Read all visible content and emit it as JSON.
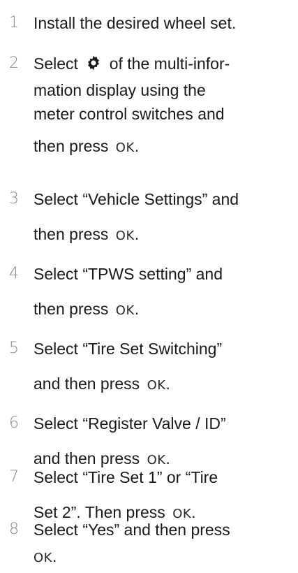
{
  "ok_label": "OK",
  "steps": [
    {
      "num": "1",
      "line1": "Install the desired wheel set."
    },
    {
      "num": "2",
      "line1_pre": "Select",
      "gear_icon": "gear-settings-icon",
      "line1_post": "of the multi-infor-",
      "line2": "mation display using the",
      "line3": "meter control switches and",
      "line4_pre": "then press",
      "line4_post": "."
    },
    {
      "num": "3",
      "line1": "Select “Vehicle Settings” and",
      "line2_pre": "then press",
      "line2_post": "."
    },
    {
      "num": "4",
      "line1": "Select “TPWS setting” and",
      "line2_pre": "then press",
      "line2_post": "."
    },
    {
      "num": "5",
      "line1": "Select “Tire Set Switching”",
      "line2_pre": "and then press",
      "line2_post": "."
    },
    {
      "num": "6",
      "line1": "Select “Register Valve / ID”",
      "line2_pre": "and then press",
      "line2_post": "."
    },
    {
      "num": "7",
      "line1": "Select “Tire Set 1” or “Tire",
      "line2_pre": "Set 2”. Then press",
      "line2_post": "."
    },
    {
      "num": "8",
      "line1": "Select “Yes” and then press",
      "line2_post": "."
    }
  ]
}
